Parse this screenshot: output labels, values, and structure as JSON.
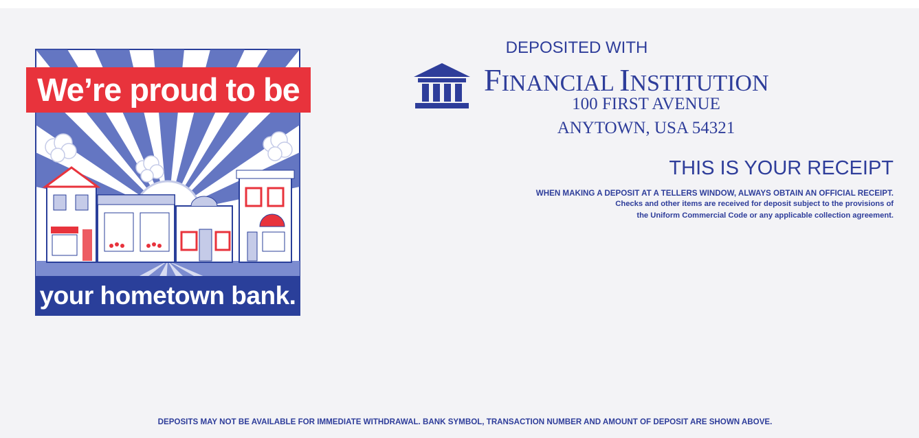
{
  "logo": {
    "top_text": "We’re proud to be",
    "bottom_text": "your hometown bank."
  },
  "header": {
    "deposited_with": "DEPOSITED WITH",
    "institution_first_initial": "F",
    "institution_first_rest": "INANCIAL ",
    "institution_second_initial": "I",
    "institution_second_rest": "NSTITUTION",
    "address_line1": "100 FIRST AVENUE",
    "address_line2": "ANYTOWN, USA 54321"
  },
  "receipt": {
    "title": "THIS IS YOUR RECEIPT",
    "notice_main": "WHEN MAKING A DEPOSIT AT A TELLERS WINDOW, ALWAYS OBTAIN AN OFFICIAL RECEIPT.",
    "notice_line2": "Checks and other items are received for deposit subject to the provisions of",
    "notice_line3": "the Uniform Commercial Code or any applicable collection agreement."
  },
  "footer": {
    "text": "DEPOSITS MAY NOT BE AVAILABLE FOR IMMEDIATE WITHDRAWAL. BANK SYMBOL, TRANSACTION NUMBER AND AMOUNT OF DEPOSIT ARE SHOWN ABOVE."
  },
  "colors": {
    "brand_blue": "#2e3d9a",
    "banner_red": "#e8333c",
    "paper": "#f3f3f6"
  }
}
